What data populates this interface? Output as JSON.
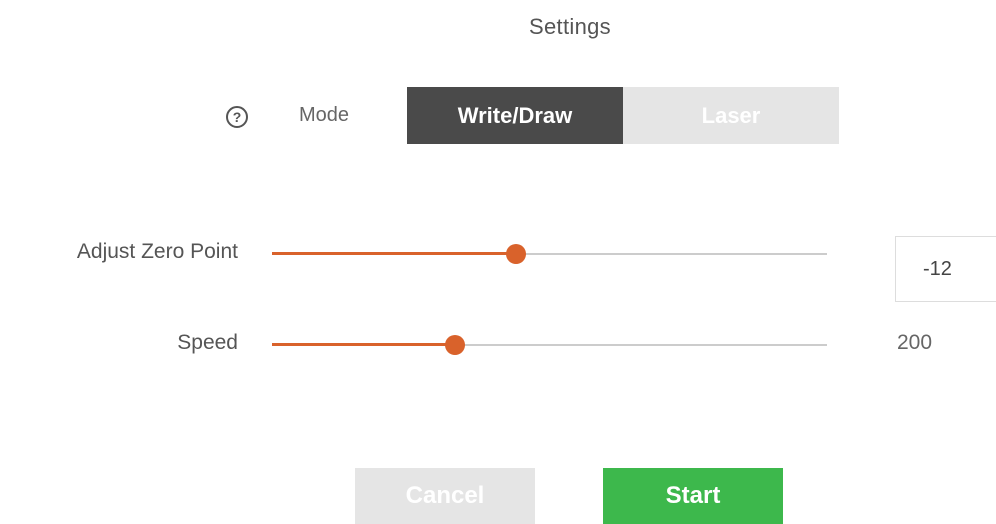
{
  "dialog": {
    "title": "Settings"
  },
  "mode": {
    "help_icon": "question-circle-icon",
    "label": "Mode",
    "options": [
      "Write/Draw",
      "Laser"
    ],
    "selected": "Write/Draw"
  },
  "zero_point": {
    "label": "Adjust Zero Point",
    "value": "-12",
    "slider_fraction": 0.44
  },
  "speed": {
    "label": "Speed",
    "value": "200",
    "slider_fraction": 0.33
  },
  "buttons": {
    "cancel": "Cancel",
    "start": "Start"
  },
  "colors": {
    "accent": "#d9622b",
    "start_button": "#3db84c",
    "mode_active": "#4a4a4a",
    "disabled": "#e5e5e5"
  }
}
